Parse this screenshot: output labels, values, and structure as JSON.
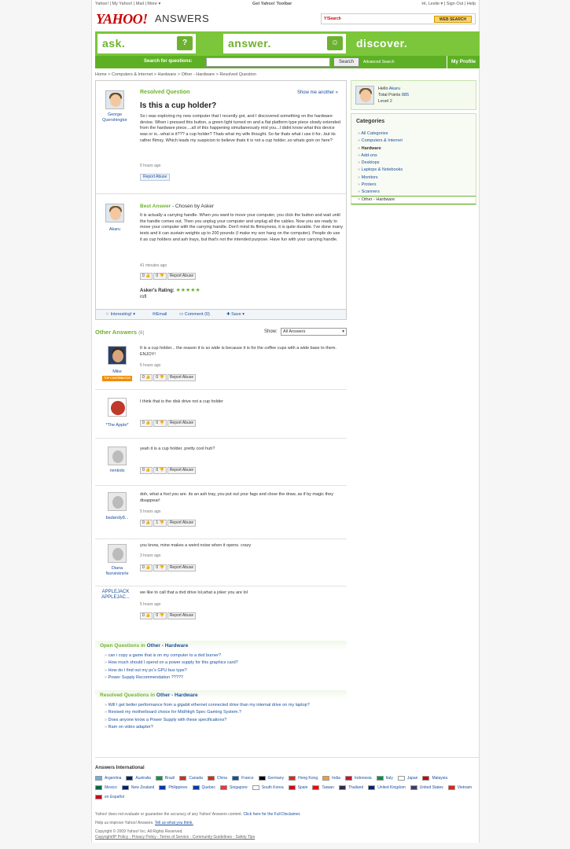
{
  "util_left": [
    "Yahoo!",
    "My Yahoo!",
    "Mail",
    "More ▾"
  ],
  "util_center": "Get Yahoo! Toolbar",
  "util_right": [
    "Hi, Leslie ▾",
    "Sign Out",
    "Help"
  ],
  "logo": "YAHOO!",
  "logo_sub": "ANSWERS",
  "web_search": {
    "brand": "Y!Search",
    "button": "WEB SEARCH"
  },
  "tabs": {
    "ask": "ask.",
    "ask_icon": "?",
    "answer": "answer.",
    "answer_icon": "☺",
    "discover": "discover."
  },
  "searchbar": {
    "label": "Search for questions:",
    "button": "Search",
    "advanced": "Advanced Search",
    "profile": "My Profile"
  },
  "breadcrumb": "Home > Computers & Internet > Hardware > Other - Hardware > Resolved Question",
  "question": {
    "status": "Resolved Question",
    "show_another": "Show me another »",
    "title": "Is this a cup holder?",
    "asker": "George Quershingtor",
    "body": "So i was exploring my new computer that I recently got, and I discovered something on the hardware devise. When i pressed this button, a green light turned on and a flat platform type piece slowly extended from the hardware piece....all of this happening simultaneously mid you...I didnt know what this device was or is...what is it??? a cup holder? Thats what my wife thought. So far thats what i use it for...but its rather flimsy. Which leads my suspicion to believe thats it is not a cup holder..so whats goin on here?",
    "time": "5 hours ago",
    "report": "Report Abuse"
  },
  "best_answer": {
    "label": "Best Answer",
    "chosen": " - Chosen by Asker",
    "user": "Akaru",
    "body": "It is actually a carrying handle. When you want to move your computer, you click the button and wait until the handle comes out. Then you unplug your computer and unplug all the cables. Now you are ready to move your computer with the carrying handle. Don't mind its flimsyness, it is quite durable. I've done many tests and it can sustain weights up to 200 pounds (I make my son hang on the computer). People do use it as cup holders and ash trays, but that's not the intended purpose. Have fun with your carrying handle.",
    "time": "41 minutes ago",
    "votes_up": "0",
    "votes_down": "0",
    "report": "Report Abuse",
    "rating_label": "Asker's Rating:",
    "stars": "★★★★★",
    "rating_comment": "rofl"
  },
  "toolbar": {
    "interesting": "Interesting! ▾",
    "email": "Email",
    "comment": "Comment (0)",
    "save": "Save ▾"
  },
  "other_answers": {
    "title": "Other Answers",
    "count": "(6)",
    "show_label": "Show:",
    "show_value": "All Answers"
  },
  "answers": [
    {
      "user": "Mike",
      "badge": "TOP CONTRIBUTOR",
      "body": "It is a cup holder... the reason it is so wide is because it is for the coffee cups with a wide base to them. ENJOY!",
      "time": "5 hours ago",
      "up": "0",
      "down": "0",
      "report": "Report Abuse"
    },
    {
      "user": "*The Apple*",
      "body": "I think that is the disk drive not a cup holder",
      "time": "",
      "up": "0",
      "down": "0",
      "report": "Report Abuse"
    },
    {
      "user": "rienkids",
      "body": "yeah it is a cup holder. pretty cool huh?",
      "time": "",
      "up": "0",
      "down": "0",
      "report": "Report Abuse"
    },
    {
      "user": "badandy8...",
      "body": "doh, what a fool you are. its an ash tray, you put out your fags and close the draw, as if by magic they disappear!",
      "time": "5 hours ago",
      "up": "0",
      "down": "1",
      "report": "Report Abuse"
    },
    {
      "user": "Diana Norvinknirle",
      "body": "you know, mine makes a weird noise when it opens. crazy",
      "time": "3 hours ago",
      "up": "0",
      "down": "0",
      "report": "Report Abuse"
    },
    {
      "user": "APPLEJACK APPLEJAC...",
      "body": "we like to call that a dvd drive lol,what a joker you are lol",
      "time": "5 hours ago",
      "up": "0",
      "down": "0",
      "report": "Report Abuse"
    }
  ],
  "open_questions": {
    "title": "Open Questions in ",
    "category": "Other - Hardware",
    "items": [
      "can i copy a game that is on my computer to a dvd burner?",
      "How much should I spend on a power supply for this graphics card?",
      "How do I find out my pc's GPU bus type?",
      "Power Supply Recommendation ?????"
    ]
  },
  "resolved_questions": {
    "title": "Resolved Questions in ",
    "category": "Other - Hardware",
    "items": [
      "Will I get better performance from a gigabit ethernet connected drive than my internal drive on my laptop?",
      "Revised my motherboard choice for Mid/High Spec Gaming System.?",
      "Does anyone know a Power Supply with these specifications?",
      "Ram on video adapter?"
    ]
  },
  "hello_box": {
    "hello": "Hello ",
    "user": "Akaru",
    "points_label": "Total Points ",
    "points": "885",
    "level_label": "Level ",
    "level": "2"
  },
  "categories": {
    "title": "Categories",
    "items": [
      "All Categories",
      "Computers & Internet",
      "Hardware",
      "Add-ons",
      "Desktops",
      "Laptops & Notebooks",
      "Monitors",
      "Printers",
      "Scanners"
    ],
    "active": "Other - Hardware"
  },
  "intl_title": "Answers International",
  "intl": [
    {
      "name": "Argentina",
      "color": "#74acdf"
    },
    {
      "name": "Australia",
      "color": "#012169"
    },
    {
      "name": "Brazil",
      "color": "#009c3b"
    },
    {
      "name": "Canada",
      "color": "#d52b1e"
    },
    {
      "name": "China",
      "color": "#de2910"
    },
    {
      "name": "France",
      "color": "#0055a4"
    },
    {
      "name": "Germany",
      "color": "#000000"
    },
    {
      "name": "Hong Kong",
      "color": "#de2910"
    },
    {
      "name": "India",
      "color": "#ff9933"
    },
    {
      "name": "Indonesia",
      "color": "#ce1126"
    },
    {
      "name": "Italy",
      "color": "#009246"
    },
    {
      "name": "Japan",
      "color": "#ffffff"
    },
    {
      "name": "Malaysia",
      "color": "#cc0001"
    },
    {
      "name": "Mexico",
      "color": "#006847"
    },
    {
      "name": "New Zealand",
      "color": "#012169"
    },
    {
      "name": "Philippines",
      "color": "#0038a8"
    },
    {
      "name": "Quebec",
      "color": "#003da5"
    },
    {
      "name": "Singapore",
      "color": "#ef3340"
    },
    {
      "name": "South Korea",
      "color": "#ffffff"
    },
    {
      "name": "Spain",
      "color": "#c60b1e"
    },
    {
      "name": "Taiwan",
      "color": "#fe0000"
    },
    {
      "name": "Thailand",
      "color": "#2d2a4a"
    },
    {
      "name": "United Kingdom",
      "color": "#012169"
    },
    {
      "name": "United States",
      "color": "#3c3b6e"
    },
    {
      "name": "Vietnam",
      "color": "#da251d"
    },
    {
      "name": "en Español",
      "color": "#c60b1e"
    }
  ],
  "footer": {
    "disclaimer": "Yahoo! does not evaluate or guarantee the accuracy of any Yahoo! Answers content. ",
    "disclaimer_link": "Click here for the Full Disclaimer.",
    "help": "Help us improve Yahoo! Answers. ",
    "help_link": "Tell us what you think.",
    "copyright": "Copyright © 2009 Yahoo! Inc. All Rights Reserved.",
    "links": "Copyright/IP Policy - Privacy Policy - Terms of Service - Community Guidelines - Safety Tips"
  }
}
